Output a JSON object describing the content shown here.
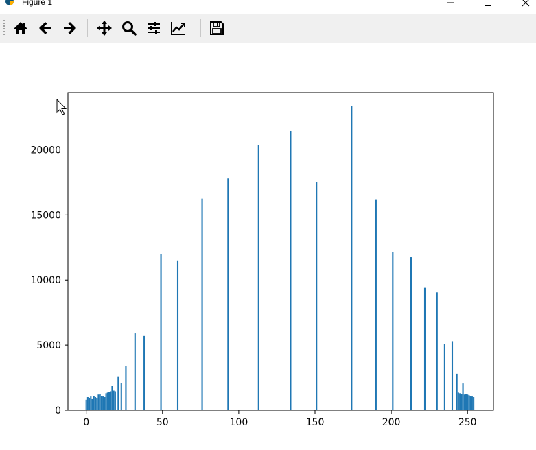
{
  "window": {
    "title": "Figure 1",
    "minimize_icon": "minimize-icon",
    "maximize_icon": "maximize-icon",
    "close_icon": "close-icon"
  },
  "toolbar": {
    "buttons": [
      {
        "name": "home-button",
        "icon": "home-icon"
      },
      {
        "name": "back-button",
        "icon": "back-arrow-icon"
      },
      {
        "name": "forward-button",
        "icon": "forward-arrow-icon"
      },
      {
        "name": "pan-button",
        "icon": "move-icon"
      },
      {
        "name": "zoom-button",
        "icon": "magnifier-icon"
      },
      {
        "name": "subplots-button",
        "icon": "sliders-icon"
      },
      {
        "name": "edit-axis-button",
        "icon": "line-chart-icon"
      },
      {
        "name": "save-button",
        "icon": "floppy-disk-icon"
      }
    ]
  },
  "colors": {
    "bar": "#1f77b4",
    "axes": "#000000",
    "toolbar_bg": "#f0f0f0"
  },
  "chart_data": {
    "type": "bar",
    "title": "",
    "xlabel": "",
    "ylabel": "",
    "xlim": [
      -12,
      267
    ],
    "ylim": [
      0,
      24400
    ],
    "xticks": [
      0,
      50,
      100,
      150,
      200,
      250
    ],
    "yticks": [
      0,
      5000,
      10000,
      15000,
      20000
    ],
    "grid": false,
    "x": [
      0,
      1,
      2,
      3,
      4,
      5,
      6,
      7,
      8,
      9,
      10,
      11,
      12,
      13,
      14,
      15,
      16,
      17,
      18,
      19,
      21,
      23,
      26,
      32,
      38,
      49,
      60,
      76,
      93,
      113,
      134,
      151,
      174,
      190,
      201,
      213,
      222,
      230,
      235,
      240,
      243,
      244,
      245,
      246,
      247,
      248,
      249,
      250,
      251,
      252,
      253,
      254
    ],
    "values": [
      800,
      1000,
      950,
      1050,
      900,
      1100,
      1000,
      950,
      1200,
      1250,
      1100,
      1050,
      1000,
      1300,
      1350,
      1400,
      1450,
      1850,
      1500,
      1450,
      2600,
      2100,
      3400,
      5900,
      5700,
      12000,
      11500,
      16250,
      17800,
      20350,
      21450,
      17500,
      23350,
      16200,
      12150,
      11750,
      9400,
      9050,
      5100,
      5300,
      2800,
      1350,
      1300,
      1250,
      2050,
      1200,
      1250,
      1200,
      1150,
      1100,
      1050,
      1000
    ]
  }
}
